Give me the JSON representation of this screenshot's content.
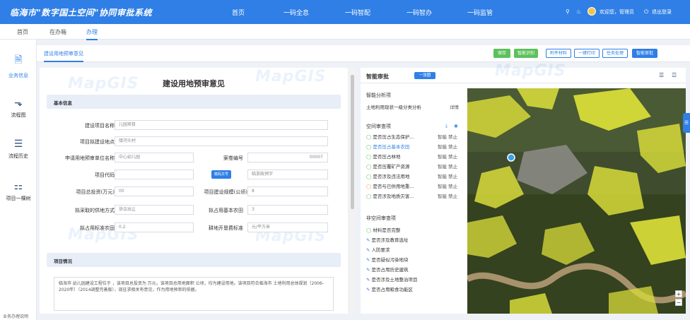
{
  "header": {
    "title": "临海市\"数字国土空间\"协同审批系统",
    "nav": [
      "首页",
      "一码全息",
      "一码智配",
      "一码智办",
      "一码监管"
    ],
    "user_greeting": "欢迎您，管理员",
    "logout": "退出登录"
  },
  "tabs": [
    "首页",
    "在办箱",
    "办理"
  ],
  "sidebar": {
    "items": [
      {
        "label": "业务信息",
        "icon": "document-icon"
      },
      {
        "label": "流程图",
        "icon": "flowchart-icon"
      },
      {
        "label": "流程历史",
        "icon": "list-icon"
      },
      {
        "label": "项目一棵树",
        "icon": "tree-icon"
      }
    ],
    "footer": "业务办理说明"
  },
  "subtab": "建设用地预审意见",
  "toolbar": [
    "保存",
    "智能识别",
    "附件材料",
    "一键打印",
    "任务处理",
    "智能审批"
  ],
  "form": {
    "title": "建设用地预审意见",
    "section_basic": "基本信息",
    "section_project": "项目情况",
    "labels": {
      "name": "建设项目名称",
      "location": "项目拟建设地点",
      "applicant": "申请用地预审单位名称",
      "case_no": "案卷编号",
      "code": "项目代码",
      "investment": "项目总投资(万元)",
      "scale": "项目建设规模(公顷)",
      "supply": "拟采取的供地方式",
      "farmland": "拟占用基本农田",
      "standard": "拟占用标准农田",
      "cultivation": "耕地开垦费标准"
    },
    "values": {
      "name": "儿园项目",
      "location": "镇河头村",
      "applicant": "中心幼儿园",
      "case_no": "00007",
      "code_btn": "赋码文号",
      "code_right": "临浙政预字",
      "investment": "00",
      "scale": "8",
      "supply": "协议出让",
      "farmland": "3",
      "standard": "0.2",
      "cultivation": "元/平方米"
    },
    "description": "临海市 幼儿园建设工程位于 ，该项目总投资为 万元，该项目总用地面积 公顷，均为建设用地。该项目符合临海市 土地利用总体规划（2006-2020年）（2014调整完善版），现征求相关有意见，作为用地预审的依据。"
  },
  "smart": {
    "title": "智能审批",
    "pill": "一张图",
    "analysis_heading": "智能分析项",
    "analysis_item": "土地利用现状一级分类分析",
    "analysis_link": "详情",
    "spatial_heading": "空间审查项",
    "spatial_items": [
      {
        "label": "是否压占生态保护...",
        "status": "智能 禁止",
        "icon": "check-icon"
      },
      {
        "label": "是否压占基本农田",
        "status": "智能 禁止",
        "icon": "check-icon"
      },
      {
        "label": "是否压占林地",
        "status": "智能 禁止",
        "icon": "check-icon"
      },
      {
        "label": "是否压覆矿产资源",
        "status": "智能 禁止",
        "icon": "check-icon"
      },
      {
        "label": "是否涉及违法用地",
        "status": "智能 禁止",
        "icon": "check-icon"
      },
      {
        "label": "是否与已供用地重...",
        "status": "智能 禁止",
        "icon": "warn-icon"
      },
      {
        "label": "是否涉及地质灾害...",
        "status": "智能 禁止",
        "icon": "check-icon"
      }
    ],
    "nonspatial_heading": "非空间审查项",
    "nonspatial_items": [
      "材料是否完整",
      "是否涉及教育选址",
      "人防要求",
      "是否疑似污染地块",
      "是否占用历史建筑",
      "是否涉及土地整治项目",
      "是否占用粮食功能区"
    ]
  },
  "watermark": "MapGIS",
  "colors": {
    "brand": "#2f7fe6",
    "green": "#5cc15c",
    "warn": "#f0a03c"
  }
}
